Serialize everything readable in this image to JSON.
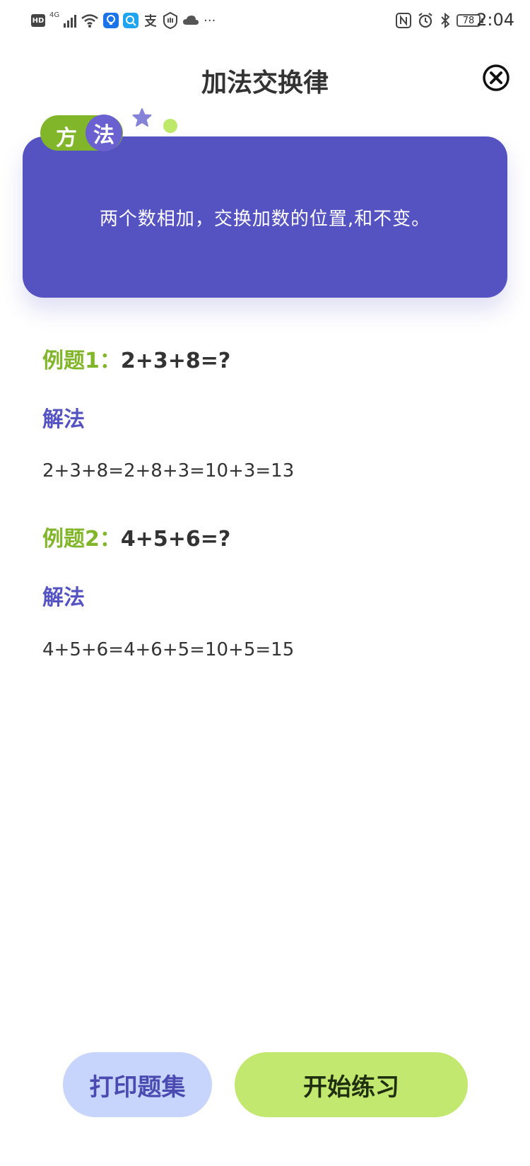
{
  "status_bar": {
    "time": "2:04",
    "battery": "78",
    "network": "4G",
    "hd": "HD",
    "more": "···"
  },
  "header": {
    "title": "加法交换律"
  },
  "method": {
    "tag_char1": "方",
    "tag_char2": "法",
    "text": "两个数相加，交换加数的位置,和不变。"
  },
  "examples": [
    {
      "label": "例题1：",
      "problem": "2+3+8=?",
      "solution_label": "解法",
      "solution": "2+3+8=2+8+3=10+3=13"
    },
    {
      "label": "例题2：",
      "problem": "4+5+6=?",
      "solution_label": "解法",
      "solution": "4+5+6=4+6+5=10+5=15"
    }
  ],
  "buttons": {
    "print": "打印题集",
    "start": "开始练习"
  },
  "colors": {
    "accent_purple": "#5553c2",
    "accent_green": "#82b62a",
    "button_green": "#c2e86f",
    "button_blue": "#c7d4fb"
  }
}
